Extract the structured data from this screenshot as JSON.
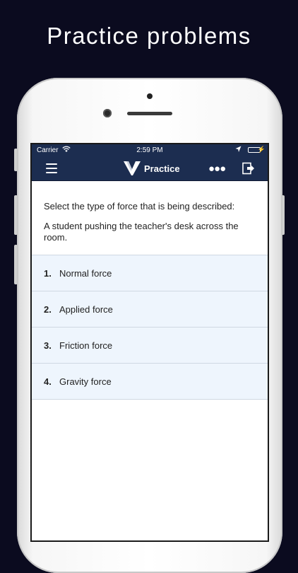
{
  "headline": "Practice problems",
  "status_bar": {
    "carrier": "Carrier",
    "time": "2:59 PM",
    "battery_color": "#4cd964"
  },
  "nav": {
    "title": "Practice",
    "menu_icon": "hamburger-icon",
    "more_icon": "more-dots-icon",
    "exit_icon": "exit-icon",
    "background": "#1c2d50"
  },
  "question": {
    "prompt": "Select the type of force that is being described:",
    "text": "A student pushing the teacher's desk across the room."
  },
  "answers": [
    {
      "num": "1.",
      "label": "Normal force"
    },
    {
      "num": "2.",
      "label": "Applied force"
    },
    {
      "num": "3.",
      "label": "Friction force"
    },
    {
      "num": "4.",
      "label": "Gravity force"
    }
  ],
  "colors": {
    "page_background": "#0b0b1f",
    "answer_background": "#eef5fd"
  }
}
